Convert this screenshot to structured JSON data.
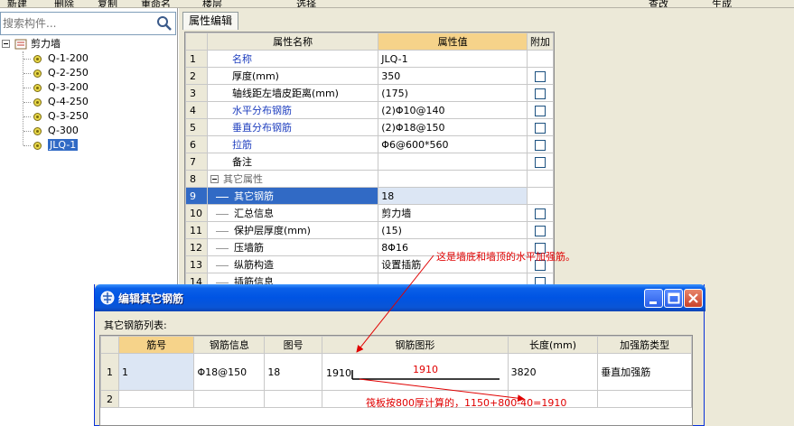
{
  "toolbar": {
    "items": [
      "新建",
      "删除",
      "复制",
      "重命名",
      "楼层",
      "",
      "",
      "选择",
      "",
      "",
      "",
      "",
      "查改",
      "生成"
    ]
  },
  "search": {
    "placeholder": "搜索构件..."
  },
  "tree": {
    "root": "剪力墙",
    "items": [
      "Q-1-200",
      "Q-2-250",
      "Q-3-200",
      "Q-4-250",
      "Q-3-250",
      "Q-300",
      "JLQ-1"
    ],
    "selected_index": 6
  },
  "tab": {
    "label": "属性编辑"
  },
  "property_grid": {
    "headers": [
      "属性名称",
      "属性值",
      "附加"
    ],
    "rows": [
      {
        "num": "1",
        "name": "名称",
        "value": "JLQ-1",
        "blue": true,
        "check": false
      },
      {
        "num": "2",
        "name": "厚度(mm)",
        "value": "350",
        "blue": false,
        "check": true
      },
      {
        "num": "3",
        "name": "轴线距左墙皮距离(mm)",
        "value": "(175)",
        "blue": false,
        "check": true
      },
      {
        "num": "4",
        "name": "水平分布钢筋",
        "value": "(2)Φ10@140",
        "blue": true,
        "check": true
      },
      {
        "num": "5",
        "name": "垂直分布钢筋",
        "value": "(2)Φ18@150",
        "blue": true,
        "check": true
      },
      {
        "num": "6",
        "name": "拉筋",
        "value": "Φ6@600*560",
        "blue": true,
        "check": true
      },
      {
        "num": "7",
        "name": "备注",
        "value": "",
        "blue": false,
        "check": true
      },
      {
        "num": "8",
        "name": "其它属性",
        "value": "",
        "group": true,
        "check": false
      },
      {
        "num": "9",
        "name": "其它钢筋",
        "value": "18",
        "sub": true,
        "selected": true,
        "check": false
      },
      {
        "num": "10",
        "name": "汇总信息",
        "value": "剪力墙",
        "sub": true,
        "check": true
      },
      {
        "num": "11",
        "name": "保护层厚度(mm)",
        "value": "(15)",
        "sub": true,
        "check": true
      },
      {
        "num": "12",
        "name": "压墙筋",
        "value": "8Φ16",
        "sub": true,
        "check": true
      },
      {
        "num": "13",
        "name": "纵筋构造",
        "value": "设置插筋",
        "sub": true,
        "check": true
      },
      {
        "num": "14",
        "name": "插筋信息",
        "value": "",
        "sub": true,
        "check": true
      }
    ]
  },
  "annotations": {
    "note1": "这是墙底和墙顶的水平加强筋。",
    "note2": "筏板按800厚计算的，1150+800-40=1910"
  },
  "dialog": {
    "title": "编辑其它钢筋",
    "list_label": "其它钢筋列表:",
    "headers": [
      "筋号",
      "钢筋信息",
      "图号",
      "钢筋图形",
      "长度(mm)",
      "加强筋类型"
    ],
    "rows": [
      {
        "num": "1",
        "id": "1",
        "info": "Φ18@150",
        "fig": "18",
        "shape_left": "1910",
        "shape_top": "1910",
        "length": "3820",
        "type": "垂直加强筋"
      },
      {
        "num": "2",
        "id": "",
        "info": "",
        "fig": "",
        "shape_left": "",
        "shape_top": "",
        "length": "",
        "type": ""
      }
    ]
  },
  "colors": {
    "title_blue": "#0054e3",
    "annotation_red": "#e00000",
    "header_orange": "#f6d38a",
    "selection_blue": "#316ac5"
  }
}
